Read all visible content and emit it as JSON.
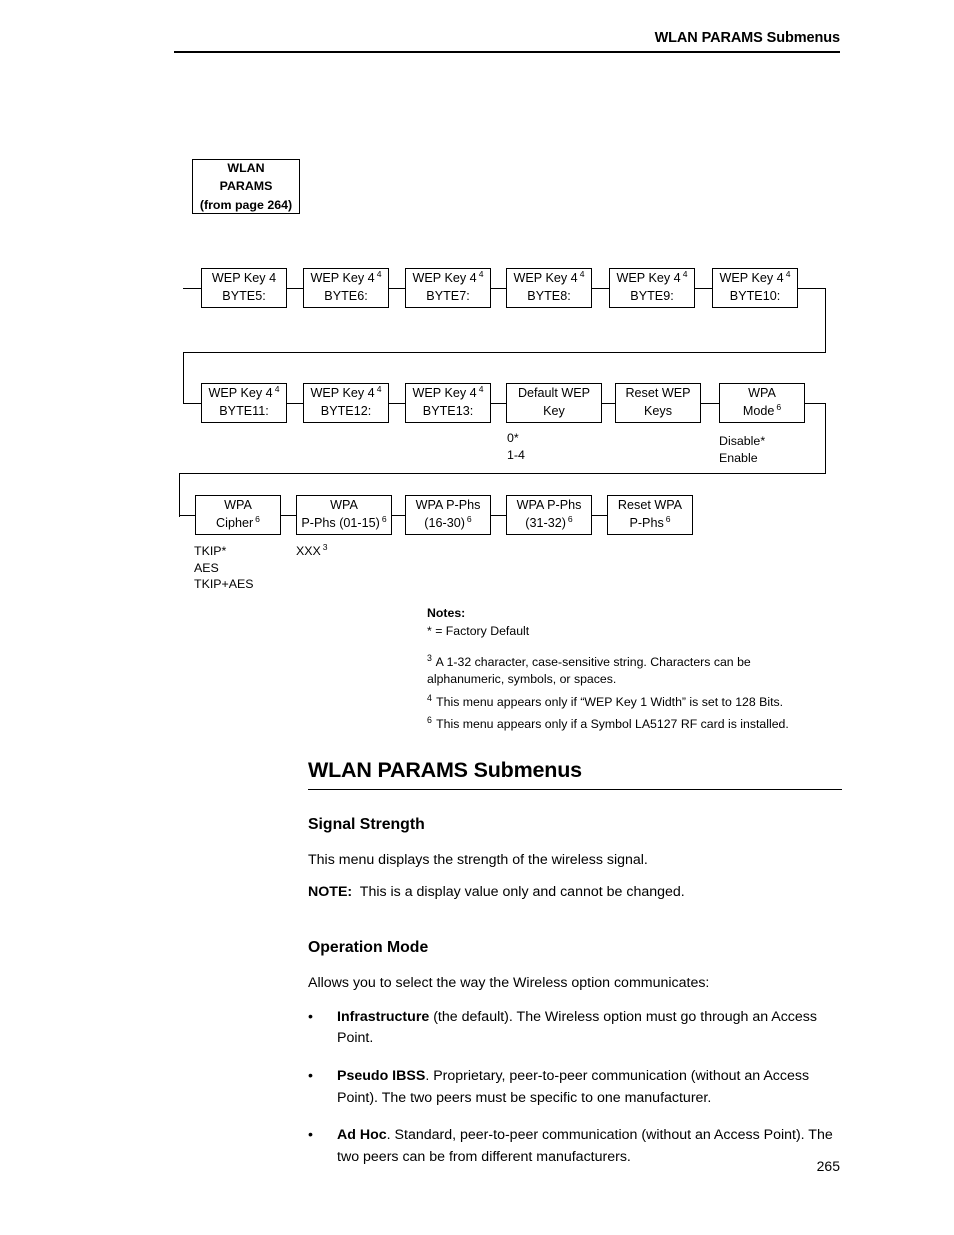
{
  "header": {
    "title": "WLAN PARAMS Submenus"
  },
  "flowchart": {
    "start_box": {
      "line1": "WLAN",
      "line2": "PARAMS",
      "line3": "(from page 264)"
    },
    "row1": [
      {
        "line1": "WEP Key 4",
        "sup1": "",
        "line2": "BYTE5:"
      },
      {
        "line1": "WEP Key 4",
        "sup1": "4",
        "line2": "BYTE6:"
      },
      {
        "line1": "WEP Key 4",
        "sup1": "4",
        "line2": "BYTE7:"
      },
      {
        "line1": "WEP Key 4",
        "sup1": "4",
        "line2": "BYTE8:"
      },
      {
        "line1": "WEP Key 4",
        "sup1": "4",
        "line2": "BYTE9:"
      },
      {
        "line1": "WEP Key 4",
        "sup1": "4",
        "line2": "BYTE10:"
      }
    ],
    "row2": [
      {
        "line1": "WEP Key 4",
        "sup1": "4",
        "line2": "BYTE11:"
      },
      {
        "line1": "WEP Key 4",
        "sup1": "4",
        "line2": "BYTE12:"
      },
      {
        "line1": "WEP Key 4",
        "sup1": "4",
        "line2": "BYTE13:"
      },
      {
        "line1": "Default WEP",
        "sup1": "",
        "line2": "Key"
      },
      {
        "line1": "Reset WEP",
        "sup1": "",
        "line2": "Keys"
      },
      {
        "line1": "WPA",
        "sup1": "",
        "line2": "Mode",
        "sup2": "6"
      }
    ],
    "row3": [
      {
        "line1": "WPA",
        "sup1": "",
        "line2": "Cipher",
        "sup2": "6"
      },
      {
        "line1": "WPA",
        "sup1": "",
        "line2": "P-Phs (01-15)",
        "sup2": "6"
      },
      {
        "line1": "WPA P-Phs",
        "sup1": "",
        "line2": "(16-30)",
        "sup2": "6"
      },
      {
        "line1": "WPA P-Phs",
        "sup1": "",
        "line2": "(31-32)",
        "sup2": "6"
      },
      {
        "line1": "Reset WPA",
        "sup1": "",
        "line2": "P-Phs",
        "sup2": "6"
      }
    ],
    "options": {
      "default_wep_key": [
        "0*",
        "1-4"
      ],
      "wpa_mode": [
        "Disable*",
        "Enable"
      ],
      "wpa_cipher": [
        "TKIP*",
        "AES",
        "TKIP+AES"
      ],
      "wpa_pphs": "XXX",
      "wpa_pphs_sup": "3"
    }
  },
  "notes": {
    "title": "Notes:",
    "factory_default": "* = Factory Default",
    "note3_sup": "3",
    "note3": "A 1-32 character, case-sensitive string. Characters can be alphanumeric, symbols, or spaces.",
    "note4_sup": "4",
    "note4": "This menu appears only if “WEP Key 1 Width” is set to 128 Bits.",
    "note6_sup": "6",
    "note6": "This menu appears only if a Symbol LA5127 RF card is installed."
  },
  "body": {
    "section_title": "WLAN PARAMS Submenus",
    "signal_strength": {
      "heading": "Signal Strength",
      "paragraph": "This menu displays the strength of the wireless signal.",
      "note_label": "NOTE:",
      "note_text": "This is a display value only and cannot be changed."
    },
    "operation_mode": {
      "heading": "Operation Mode",
      "intro": "Allows you to select the way the Wireless option communicates:",
      "bullet_char": "•",
      "bullets": [
        {
          "term": "Infrastructure",
          "rest": " (the default). The Wireless option must go through an Access Point."
        },
        {
          "term": "Pseudo IBSS",
          "rest": ". Proprietary, peer-to-peer communication (without an Access Point). The two peers must be specific to one manufacturer."
        },
        {
          "term": "Ad Hoc",
          "rest": ". Standard, peer-to-peer communication (without an Access Point). The two peers can be from different manufacturers."
        }
      ]
    }
  },
  "folio": {
    "page_number": "265"
  }
}
